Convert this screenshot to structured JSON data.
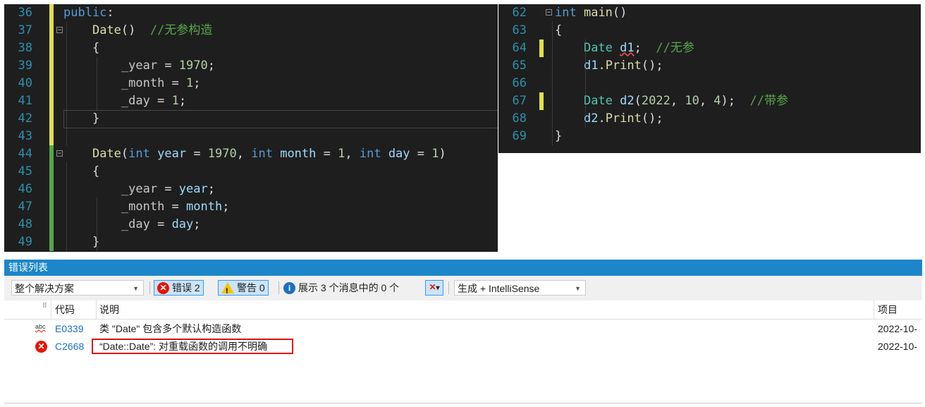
{
  "left_editor": {
    "lines": [
      {
        "num": "36",
        "html": "<span class=\"kw\">public</span>:"
      },
      {
        "num": "37",
        "html": "    <span class=\"fn\">Date</span>()  <span class=\"cm\">//无参构造</span>"
      },
      {
        "num": "38",
        "html": "    {"
      },
      {
        "num": "39",
        "html": "        <span class=\"mem\">_year</span> = <span class=\"num\">1970</span>;"
      },
      {
        "num": "40",
        "html": "        <span class=\"mem\">_month</span> = <span class=\"num\">1</span>;"
      },
      {
        "num": "41",
        "html": "        <span class=\"mem\">_day</span> = <span class=\"num\">1</span>;"
      },
      {
        "num": "42",
        "html": "    }"
      },
      {
        "num": "43",
        "html": ""
      },
      {
        "num": "44",
        "html": "    <span class=\"fn\">Date</span>(<span class=\"kw\">int</span> <span class=\"par\">year</span> = <span class=\"num\">1970</span>, <span class=\"kw\">int</span> <span class=\"par\">month</span> = <span class=\"num\">1</span>, <span class=\"kw\">int</span> <span class=\"par\">day</span> = <span class=\"num\">1</span>)"
      },
      {
        "num": "45",
        "html": "    {"
      },
      {
        "num": "46",
        "html": "        <span class=\"mem\">_year</span> = <span class=\"par\">year</span>;"
      },
      {
        "num": "47",
        "html": "        <span class=\"mem\">_month</span> = <span class=\"par\">month</span>;"
      },
      {
        "num": "48",
        "html": "        <span class=\"mem\">_day</span> = <span class=\"par\">day</span>;"
      },
      {
        "num": "49",
        "html": "    }"
      }
    ]
  },
  "right_editor": {
    "lines": [
      {
        "num": "62",
        "html": "<span class=\"kw\">int</span> <span class=\"fn\">main</span>()"
      },
      {
        "num": "63",
        "html": "{"
      },
      {
        "num": "64",
        "html": "    <span class=\"ty\">Date</span> <span class=\"par sq\">d1</span>;  <span class=\"cm\">//无参</span>"
      },
      {
        "num": "65",
        "html": "    <span class=\"par\">d1</span>.<span class=\"fn\">Print</span>();"
      },
      {
        "num": "66",
        "html": ""
      },
      {
        "num": "67",
        "html": "    <span class=\"ty\">Date</span> <span class=\"par\">d2</span>(<span class=\"num\">2022</span>, <span class=\"num\">10</span>, <span class=\"num\">4</span>);  <span class=\"cm\">//带参</span>"
      },
      {
        "num": "68",
        "html": "    <span class=\"par\">d2</span>.<span class=\"fn\">Print</span>();"
      },
      {
        "num": "69",
        "html": "}"
      }
    ]
  },
  "error_list": {
    "title": "错误列表",
    "scope": "整个解决方案",
    "errors_label": "错误 2",
    "warnings_label": "警告 0",
    "messages_label": "展示 3 个消息中的 0 个",
    "build_filter": "生成 + IntelliSense",
    "columns": {
      "code": "代码",
      "description": "说明",
      "project": "项目"
    },
    "rows": [
      {
        "code": "E0339",
        "description": "类 \"Date\" 包含多个默认构造函数",
        "project": "2022-10-",
        "icon": "abc-squiggle-icon"
      },
      {
        "code": "C2668",
        "description": "“Date::Date”: 对重载函数的调用不明确",
        "project": "2022-10-",
        "icon": "error-icon"
      }
    ],
    "colors": {
      "title_bar": "#1c86c8",
      "error": "#e51400",
      "warning": "#f5c400",
      "info": "#1e6fbf"
    }
  }
}
